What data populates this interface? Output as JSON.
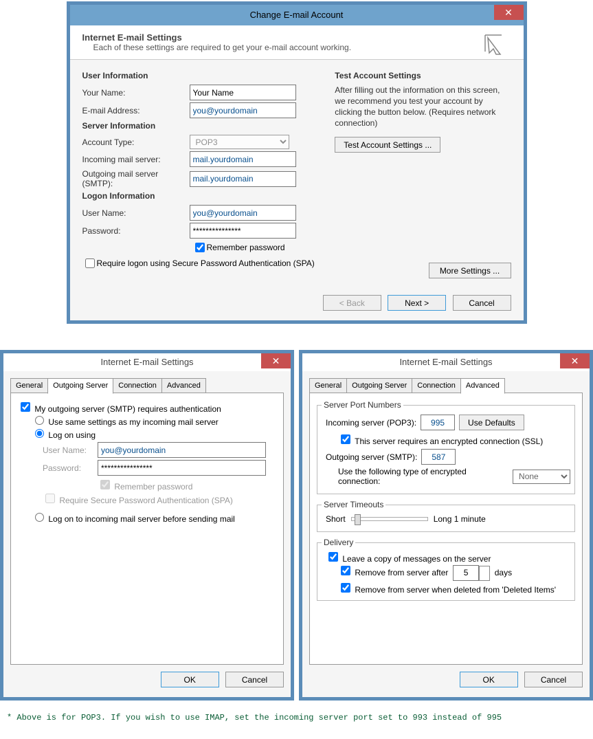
{
  "d1": {
    "title": "Change E-mail Account",
    "headTitle": "Internet E-mail Settings",
    "headSub": "Each of these settings are required to get your e-mail account working.",
    "secUser": "User Information",
    "yourNameL": "Your Name:",
    "yourNameV": "Your Name",
    "emailL": "E-mail Address:",
    "emailV": "you@yourdomain",
    "secServer": "Server Information",
    "acctTypeL": "Account Type:",
    "acctTypeV": "POP3",
    "incomingL": "Incoming mail server:",
    "incomingV": "mail.yourdomain",
    "outgoingL": "Outgoing mail server (SMTP):",
    "outgoingV": "mail.yourdomain",
    "secLogon": "Logon Information",
    "userNameL": "User Name:",
    "userNameV": "you@yourdomain",
    "passwordL": "Password:",
    "passwordV": "***************",
    "rememberL": "Remember password",
    "spaL": "Require logon using Secure Password Authentication (SPA)",
    "testH": "Test Account Settings",
    "testP": "After filling out the information on this screen, we recommend you test your account by clicking the button below. (Requires network connection)",
    "testBtn": "Test Account Settings ...",
    "moreBtn": "More Settings ...",
    "backBtn": "< Back",
    "nextBtn": "Next >",
    "cancelBtn": "Cancel"
  },
  "d2": {
    "title": "Internet E-mail Settings",
    "tabGeneral": "General",
    "tabOutgoing": "Outgoing Server",
    "tabConnection": "Connection",
    "tabAdvanced": "Advanced",
    "cb1": "My outgoing server (SMTP) requires authentication",
    "r1": "Use same settings as my incoming mail server",
    "r2": "Log on using",
    "userL": "User Name:",
    "userV": "you@yourdomain",
    "passL": "Password:",
    "passV": "****************",
    "remember": "Remember password",
    "spa": "Require Secure Password Authentication (SPA)",
    "r3": "Log on to incoming mail server before sending mail",
    "ok": "OK",
    "cancel": "Cancel"
  },
  "d3": {
    "title": "Internet E-mail Settings",
    "tabGeneral": "General",
    "tabOutgoing": "Outgoing Server",
    "tabConnection": "Connection",
    "tabAdvanced": "Advanced",
    "portH": "Server Port Numbers",
    "incL": "Incoming server (POP3):",
    "incV": "995",
    "defaults": "Use Defaults",
    "ssl": "This server requires an encrypted connection (SSL)",
    "outL": "Outgoing server (SMTP):",
    "outV": "587",
    "encL": "Use the following type of encrypted connection:",
    "encV": "None",
    "timeoutH": "Server Timeouts",
    "short": "Short",
    "long": "Long",
    "minute": "1 minute",
    "delH": "Delivery",
    "leave": "Leave a copy of messages on the server",
    "removeAfter": "Remove from server after",
    "days": "days",
    "daysV": "5",
    "removeDeleted": "Remove from server when deleted from 'Deleted Items'",
    "ok": "OK",
    "cancel": "Cancel"
  },
  "footnote": "* Above is for POP3. If you wish to use IMAP, set the incoming server port set to 993 instead of 995"
}
